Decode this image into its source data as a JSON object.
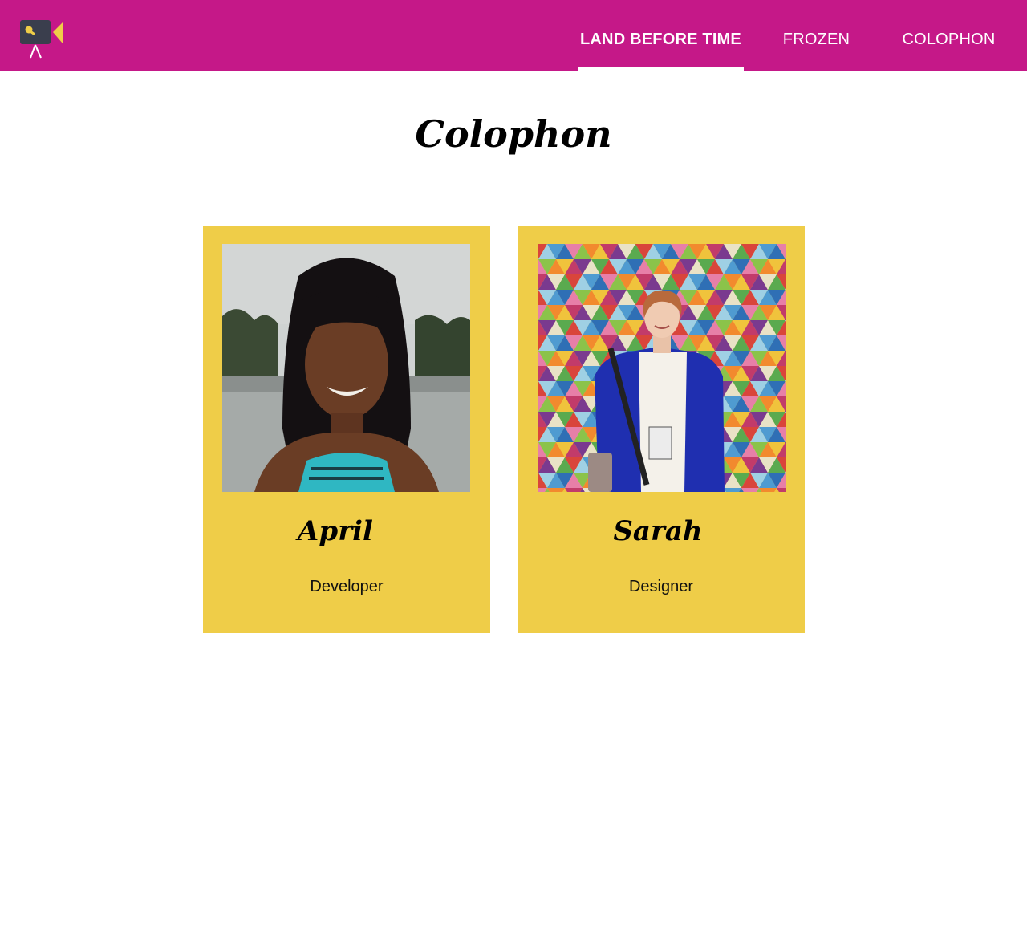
{
  "header": {
    "background": "#c51888",
    "logo_icon": "video-camera-on-tripod-icon",
    "nav": [
      {
        "label": "LAND BEFORE TIME",
        "active": true
      },
      {
        "label": "FROZEN",
        "active": false
      },
      {
        "label": "COLOPHON",
        "active": false
      }
    ]
  },
  "main": {
    "title": "Colophon",
    "card_color": "#efcd48",
    "people": [
      {
        "name": "April",
        "role": "Developer",
        "photo": "portrait-photo-april"
      },
      {
        "name": "Sarah",
        "role": "Designer",
        "photo": "portrait-photo-sarah"
      }
    ]
  }
}
